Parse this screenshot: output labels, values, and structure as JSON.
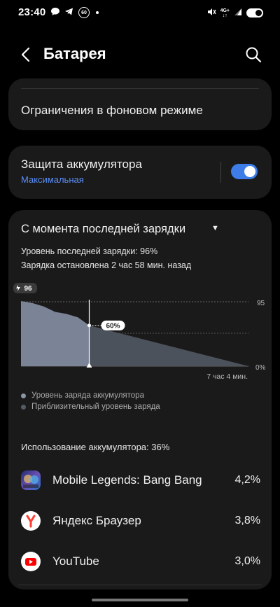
{
  "status_bar": {
    "time": "23:40",
    "left_badge": "60",
    "network": "4G+",
    "icons_left": [
      "chat-bubble-icon",
      "telegram-icon",
      "badge-icon",
      "dot-icon"
    ],
    "icons_right": [
      "mute-icon",
      "network-icon",
      "signal-icon",
      "battery-toggle-icon"
    ]
  },
  "appbar": {
    "title": "Батарея"
  },
  "card_background": {
    "label": "Ограничения в фоновом режиме"
  },
  "card_protection": {
    "label": "Защита аккумулятора",
    "sub": "Максимальная",
    "enabled": true
  },
  "card_usage": {
    "header": "С момента последней зарядки",
    "info1": "Уровень последней зарядки: 96%",
    "info2": "Зарядка остановлена 2 час 58 мин. назад",
    "usage_total": "Использование аккумулятора: 36%",
    "legend": [
      {
        "label": "Уровень заряда аккумулятора",
        "color": "#8b95a6"
      },
      {
        "label": "Приблизительный уровень заряда",
        "color": "#555b64"
      }
    ],
    "apps": [
      {
        "name": "Mobile Legends: Bang Bang",
        "pct": "4,2%",
        "icon": "mobile-legends-icon"
      },
      {
        "name": "Яндекс Браузер",
        "pct": "3,8%",
        "icon": "yandex-browser-icon"
      },
      {
        "name": "YouTube",
        "pct": "3,0%",
        "icon": "youtube-icon"
      }
    ]
  },
  "chart_data": {
    "type": "area",
    "start_label": "96",
    "current_label": "60%",
    "y_top_label": "95",
    "y_bottom_label": "0%",
    "x_end_label": "7 час 4 мин.",
    "ylim": [
      0,
      100
    ],
    "series": [
      {
        "x": [
          0,
          0.05,
          0.1,
          0.15,
          0.2,
          0.25,
          0.3
        ],
        "y": [
          96,
          93,
          88,
          80,
          77,
          72,
          60
        ]
      },
      {
        "x": [
          0.3,
          1.0
        ],
        "y": [
          60,
          0
        ]
      }
    ]
  }
}
